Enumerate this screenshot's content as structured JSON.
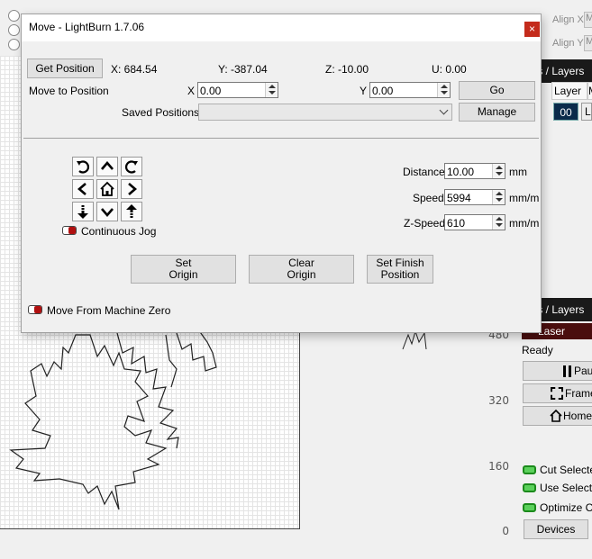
{
  "dialog": {
    "title": "Move - LightBurn 1.7.06",
    "close_glyph": "×",
    "get_position_label": "Get Position",
    "x_readout": "X: 684.54",
    "y_readout": "Y: -387.04",
    "z_readout": "Z: -10.00",
    "u_readout": "U: 0.00",
    "move_to_position_label": "Move to Position",
    "x_label": "X",
    "x_value": "0.00",
    "y_label": "Y",
    "y_value": "0.00",
    "go_label": "Go",
    "saved_positions_label": "Saved Positions:",
    "saved_positions_value": "",
    "manage_label": "Manage",
    "distance_label": "Distance",
    "distance_value": "10.00",
    "distance_unit": "mm",
    "speed_label": "Speed",
    "speed_value": "5994",
    "speed_unit": "mm/m",
    "zspeed_label": "Z-Speed",
    "zspeed_value": "610",
    "zspeed_unit": "mm/m",
    "continuous_jog_label": "Continuous Jog",
    "set_origin_label": "Set Origin",
    "clear_origin_label": "Clear Origin",
    "set_finish_label": "Set Finish Position",
    "move_from_zero_label": "Move From Machine Zero"
  },
  "background": {
    "align_x_label": "Align X",
    "align_y_label": "Align Y",
    "align_box_text": "M",
    "cuts_layers_title": "ts / Layers",
    "layer_header": "Layer",
    "layer_header_extra": "M",
    "layer_row_value": "00",
    "layer_row_extra": "L",
    "cuts_layers_title_2": "ts / Layers",
    "laser_title": "Laser",
    "status": "Ready",
    "pause_label": "Pau",
    "frame_label": "Frame",
    "home_label": "Home",
    "cut_selected_label": "Cut Selecte",
    "use_selection_label": "Use Selectio",
    "optimize_label": "Optimize Cu",
    "devices_label": "Devices",
    "ruler_labels": [
      "480",
      "320",
      "160",
      "0"
    ]
  },
  "colors": {
    "close_red": "#c42b1c",
    "panel_dark": "#1a1a1a",
    "laser_bar": "#4a0e0e",
    "layer_blue": "#0a2a4a",
    "toggle_green": "#5bd05b",
    "toggle_red": "#b01010"
  }
}
